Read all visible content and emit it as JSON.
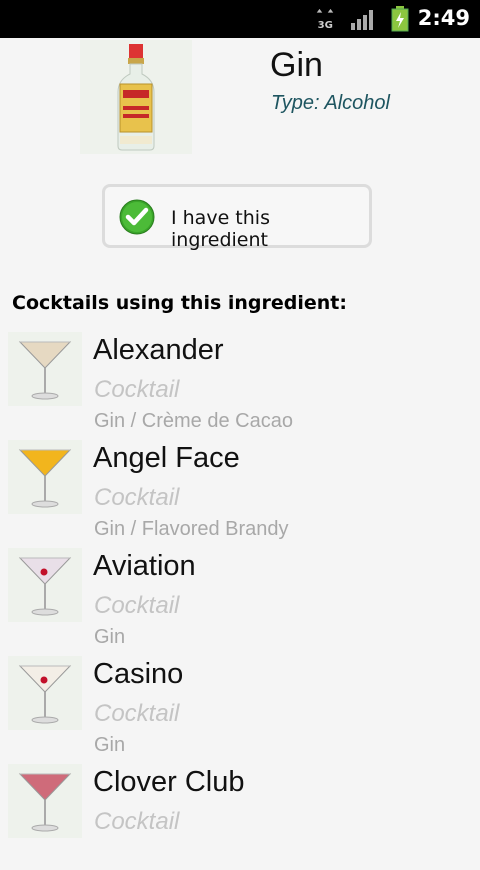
{
  "status_bar": {
    "network": "3G",
    "time": "2:49",
    "icons": [
      "network-3g-icon",
      "signal-icon",
      "battery-charging-icon"
    ]
  },
  "ingredient": {
    "name": "Gin",
    "type": "Type: Alcohol",
    "image": "gin-bottle-image"
  },
  "have_button": {
    "label": "I have this ingredient",
    "checked": true
  },
  "section_title": "Cocktails using this ingredient:",
  "cocktails": [
    {
      "name": "Alexander",
      "kind": "Cocktail",
      "ingredients": "Gin / Crème de Cacao",
      "liquid": "#e6d9c2",
      "garnish": false
    },
    {
      "name": "Angel Face",
      "kind": "Cocktail",
      "ingredients": "Gin / Flavored Brandy",
      "liquid": "#f2b51d",
      "garnish": false
    },
    {
      "name": "Aviation",
      "kind": "Cocktail",
      "ingredients": "Gin",
      "liquid": "#e9dfe8",
      "garnish": true
    },
    {
      "name": "Casino",
      "kind": "Cocktail",
      "ingredients": "Gin",
      "liquid": "#f3eee6",
      "garnish": true
    },
    {
      "name": "Clover Club",
      "kind": "Cocktail",
      "ingredients": "",
      "liquid": "#cf6b7a",
      "garnish": false
    }
  ]
}
